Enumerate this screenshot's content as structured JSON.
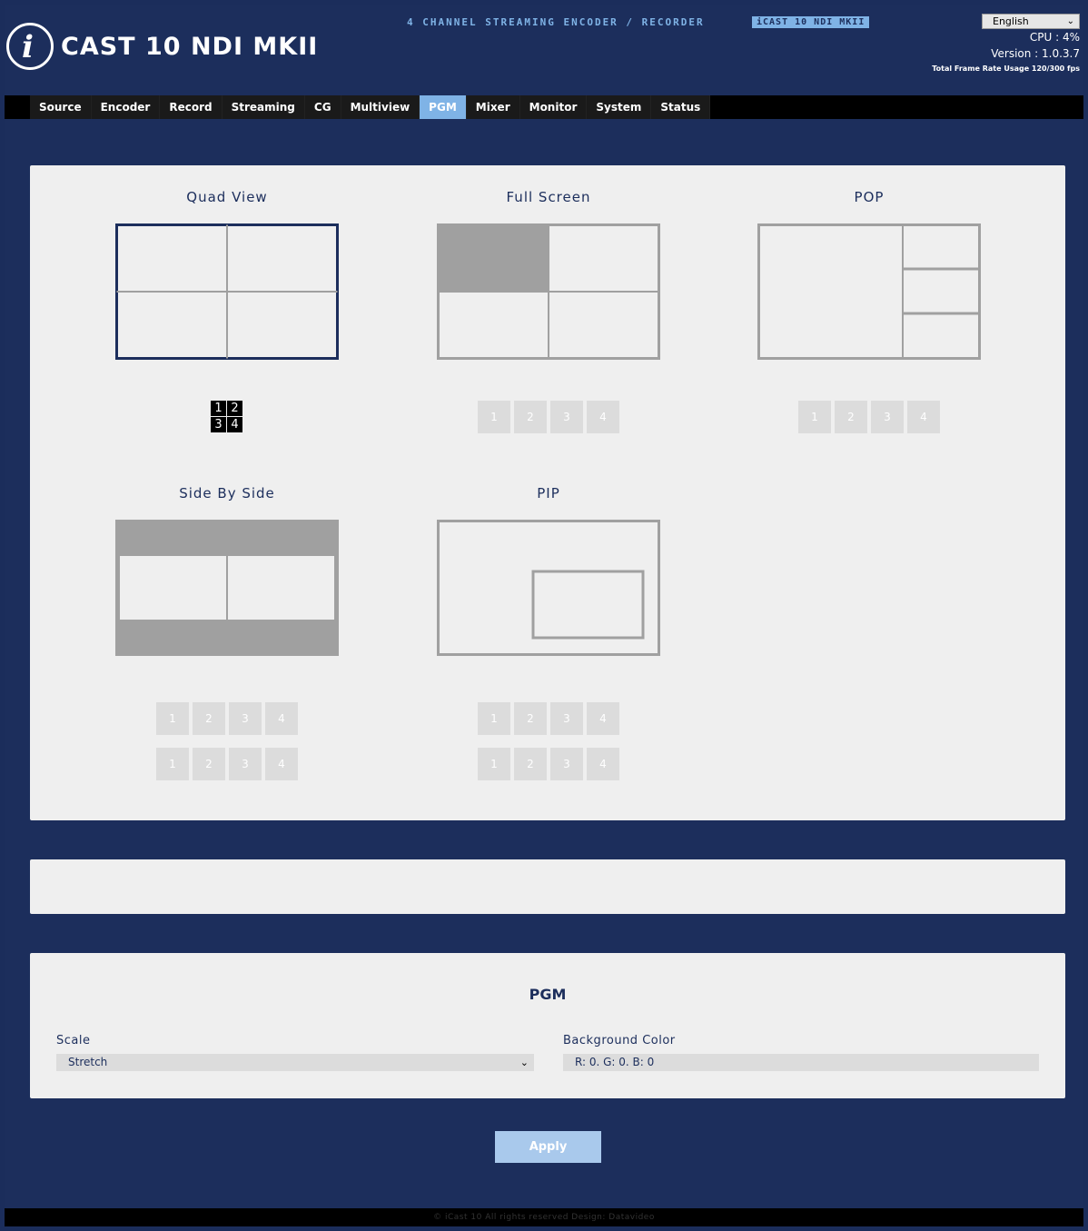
{
  "header": {
    "logo_text": "CAST 10 NDI MKII",
    "logo_mark": "i",
    "tagline": "4 CHANNEL STREAMING ENCODER / RECORDER",
    "model_badge": "iCAST 10 NDI MKII",
    "language": "English",
    "cpu": "CPU  : 4%",
    "version": "Version : 1.0.3.7",
    "frame_rate": "Total Frame Rate Usage 120/300 fps"
  },
  "nav": {
    "tabs": [
      "Source",
      "Encoder",
      "Record",
      "Streaming",
      "CG",
      "Multiview",
      "PGM",
      "Mixer",
      "Monitor",
      "System",
      "Status"
    ],
    "active": "PGM"
  },
  "layouts": {
    "quad_view": {
      "title": "Quad View",
      "icon_digits": [
        "1",
        "2",
        "3",
        "4"
      ]
    },
    "full_screen": {
      "title": "Full Screen",
      "buttons": [
        "1",
        "2",
        "3",
        "4"
      ]
    },
    "pop": {
      "title": "POP",
      "buttons": [
        "1",
        "2",
        "3",
        "4"
      ]
    },
    "side_by_side": {
      "title": "Side By Side",
      "buttons_row1": [
        "1",
        "2",
        "3",
        "4"
      ],
      "buttons_row2": [
        "1",
        "2",
        "3",
        "4"
      ]
    },
    "pip": {
      "title": "PIP",
      "buttons_row1": [
        "1",
        "2",
        "3",
        "4"
      ],
      "buttons_row2": [
        "1",
        "2",
        "3",
        "4"
      ]
    }
  },
  "pgm": {
    "title": "PGM",
    "scale_label": "Scale",
    "scale_value": "Stretch",
    "bg_label": "Background Color",
    "bg_value": "R: 0. G: 0. B: 0"
  },
  "apply_label": "Apply",
  "footer": "© iCast 10 All rights reserved Design: Datavideo",
  "colors": {
    "navy": "#1c2e5c",
    "accent": "#7fb3e6",
    "panel": "#efefef",
    "frame_inactive": "#a0a0a0"
  }
}
